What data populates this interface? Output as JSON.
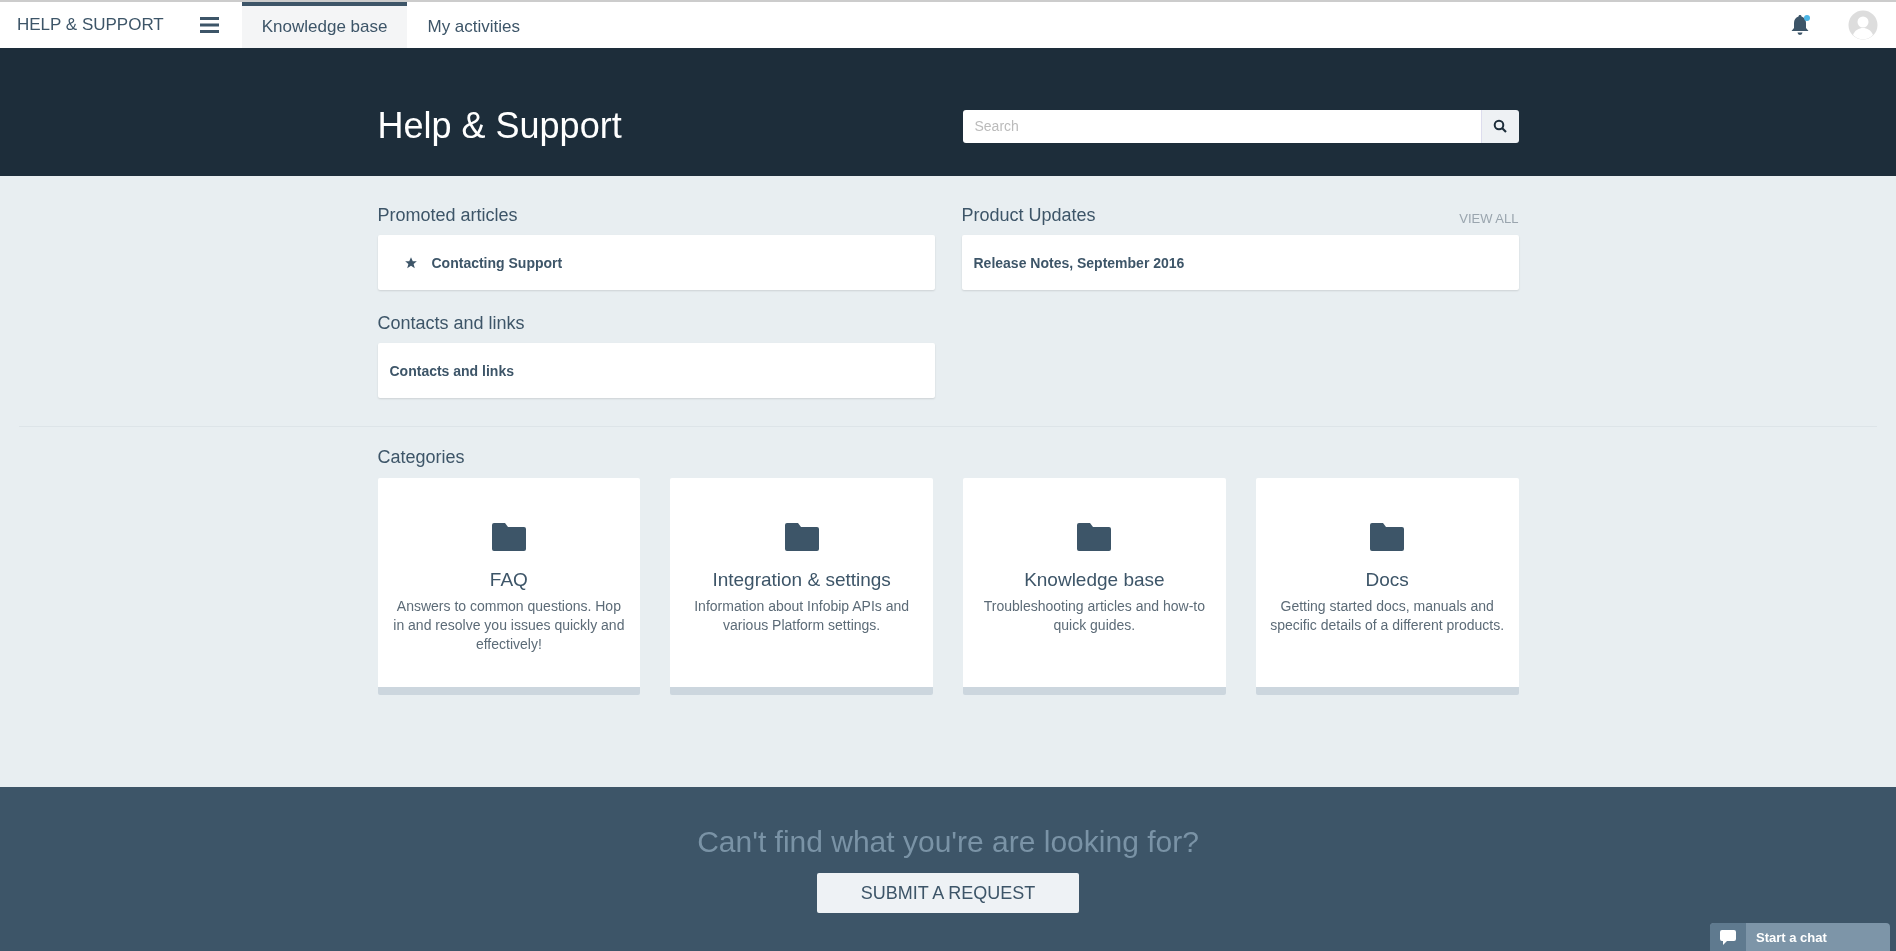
{
  "topbar": {
    "brand": "HELP & SUPPORT",
    "tabs": [
      {
        "label": "Knowledge base",
        "selected": true
      },
      {
        "label": "My activities",
        "selected": false
      }
    ],
    "notification_unread": true
  },
  "hero": {
    "title": "Help & Support",
    "search": {
      "placeholder": "Search"
    }
  },
  "promoted": {
    "title": "Promoted articles",
    "items": [
      {
        "label": "Contacting Support",
        "starred": true
      }
    ]
  },
  "updates": {
    "title": "Product Updates",
    "view_all": "VIEW ALL",
    "items": [
      {
        "label": "Release Notes, September 2016",
        "starred": false
      }
    ]
  },
  "contacts": {
    "title": "Contacts and links",
    "items": [
      {
        "label": "Contacts and links",
        "starred": false
      }
    ]
  },
  "categories": {
    "title": "Categories",
    "items": [
      {
        "title": "FAQ",
        "description": "Answers to common questions. Hop in and resolve you issues quickly and effectively!"
      },
      {
        "title": "Integration & settings",
        "description": "Information about Infobip APIs and various Platform settings."
      },
      {
        "title": "Knowledge base",
        "description": "Troubleshooting articles and how-to quick guides."
      },
      {
        "title": "Docs",
        "description": "Getting started docs, manuals and specific details of a different products."
      }
    ]
  },
  "footer": {
    "question": "Can't find what you're are looking for?",
    "button": "SUBMIT A REQUEST"
  },
  "chat": {
    "label": "Start a chat"
  }
}
